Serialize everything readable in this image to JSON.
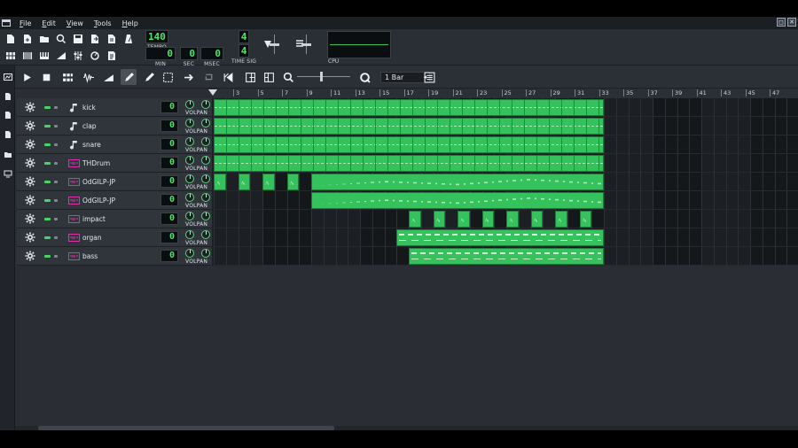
{
  "menu": [
    "File",
    "Edit",
    "View",
    "Tools",
    "Help"
  ],
  "window_buttons": [
    "◻",
    "✕"
  ],
  "toolbar": {
    "tempo": {
      "value": "140",
      "label": "TEMPO"
    },
    "time": {
      "min": "0",
      "sec": "0",
      "msec": "0",
      "min_label": "MIN",
      "sec_label": "SEC",
      "msec_label": "MSEC"
    },
    "time_sig": {
      "numerator": "4",
      "denominator": "4",
      "label": "TIME SIG"
    },
    "cpu_label": "CPU"
  },
  "song_editor": {
    "quantize": "1 Bar",
    "ruler_ticks": [
      "3",
      "5",
      "7",
      "9",
      "11",
      "13",
      "15",
      "17",
      "19",
      "21",
      "23",
      "25",
      "27",
      "29",
      "31",
      "33",
      "35",
      "37",
      "39",
      "41",
      "43",
      "45",
      "47"
    ],
    "tracks": [
      {
        "name": "kick",
        "type": "sample",
        "lcd": "0",
        "volpan": "VOLPAN"
      },
      {
        "name": "clap",
        "type": "sample",
        "lcd": "0",
        "volpan": "VOLPAN"
      },
      {
        "name": "snare",
        "type": "sample",
        "lcd": "0",
        "volpan": "VOLPAN"
      },
      {
        "name": "THDrum",
        "type": "synth",
        "lcd": "0",
        "volpan": "VOLPAN"
      },
      {
        "name": "OdGILP-JP",
        "type": "synth",
        "lcd": "0",
        "volpan": "VOLPAN"
      },
      {
        "name": "OdGILP-JP",
        "type": "synth",
        "lcd": "0",
        "volpan": "VOLPAN"
      },
      {
        "name": "impact",
        "type": "synth",
        "lcd": "0",
        "volpan": "VOLPAN"
      },
      {
        "name": "organ",
        "type": "synth",
        "lcd": "0",
        "volpan": "VOLPAN"
      },
      {
        "name": "bass",
        "type": "synth",
        "lcd": "0",
        "volpan": "VOLPAN"
      }
    ],
    "clips": [
      [
        {
          "start": 1,
          "end": 33,
          "style": "bb"
        }
      ],
      [
        {
          "start": 1,
          "end": 33,
          "style": "bb"
        }
      ],
      [
        {
          "start": 1,
          "end": 33,
          "style": "bb"
        }
      ],
      [
        {
          "start": 1,
          "end": 33,
          "style": "bb"
        }
      ],
      [
        {
          "start": 1,
          "end": 2,
          "style": "pat"
        },
        {
          "start": 3,
          "end": 4,
          "style": "pat"
        },
        {
          "start": 5,
          "end": 6,
          "style": "pat"
        },
        {
          "start": 7,
          "end": 8,
          "style": "pat"
        },
        {
          "start": 9,
          "end": 33,
          "style": "pat"
        }
      ],
      [
        {
          "start": 9,
          "end": 33,
          "style": "pat"
        }
      ],
      [
        {
          "start": 17,
          "end": 18,
          "style": "pat"
        },
        {
          "start": 19,
          "end": 20,
          "style": "pat"
        },
        {
          "start": 21,
          "end": 22,
          "style": "pat"
        },
        {
          "start": 23,
          "end": 24,
          "style": "pat"
        },
        {
          "start": 25,
          "end": 26,
          "style": "pat"
        },
        {
          "start": 27,
          "end": 28,
          "style": "pat"
        },
        {
          "start": 29,
          "end": 30,
          "style": "pat"
        },
        {
          "start": 31,
          "end": 32,
          "style": "pat"
        }
      ],
      [
        {
          "start": 16,
          "end": 33,
          "style": "notes"
        }
      ],
      [
        {
          "start": 17,
          "end": 33,
          "style": "notes"
        }
      ]
    ]
  },
  "colors": {
    "clip": "#35c25c",
    "lcd": "#4fe36a",
    "bg": "#262b31"
  }
}
